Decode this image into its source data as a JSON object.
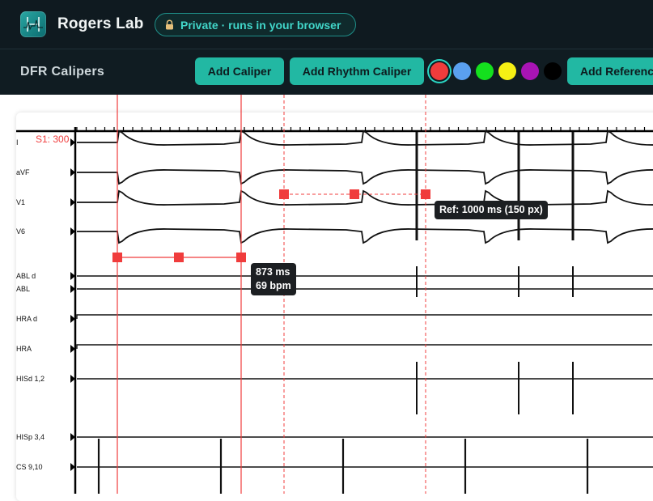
{
  "header": {
    "app_title": "Rogers Lab",
    "private_badge": "Private · runs in your browser"
  },
  "toolbar": {
    "section_title": "DFR Calipers",
    "add_caliper": "Add Caliper",
    "add_rhythm_caliper": "Add Rhythm Caliper",
    "add_reference": "Add Reference",
    "colors": [
      {
        "name": "red",
        "hex": "#f03c3c",
        "selected": true
      },
      {
        "name": "blue",
        "hex": "#5aa0f0",
        "selected": false
      },
      {
        "name": "green",
        "hex": "#14e01e",
        "selected": false
      },
      {
        "name": "yellow",
        "hex": "#f5f014",
        "selected": false
      },
      {
        "name": "purple",
        "hex": "#a814b4",
        "selected": false
      },
      {
        "name": "black",
        "hex": "#000000",
        "selected": false
      }
    ]
  },
  "tracing": {
    "stim_label": "S1: 300",
    "leads": [
      "I",
      "aVF",
      "V1",
      "V6",
      "ABL d",
      "ABL",
      "HRA d",
      "HRA",
      "HISd 1,2",
      "HISp 3,4",
      "CS 9,10"
    ]
  },
  "calipers": {
    "measure": {
      "ms_label": "873 ms",
      "bpm_label": "69 bpm"
    },
    "reference": {
      "label": "Ref: 1000 ms (150 px)"
    }
  },
  "colors": {
    "caliper": "#f03c3c",
    "accent": "#22b8a3",
    "header_bg": "#0f1a20"
  }
}
